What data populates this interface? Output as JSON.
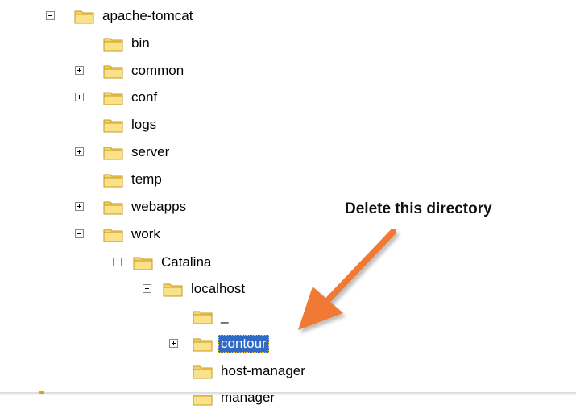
{
  "tree": {
    "nodes": [
      {
        "id": "apache-tomcat",
        "label": "apache-tomcat",
        "toggle": "minus"
      },
      {
        "id": "bin",
        "label": "bin",
        "toggle": "none"
      },
      {
        "id": "common",
        "label": "common",
        "toggle": "plus"
      },
      {
        "id": "conf",
        "label": "conf",
        "toggle": "plus"
      },
      {
        "id": "logs",
        "label": "logs",
        "toggle": "none"
      },
      {
        "id": "server",
        "label": "server",
        "toggle": "plus"
      },
      {
        "id": "temp",
        "label": "temp",
        "toggle": "none"
      },
      {
        "id": "webapps",
        "label": "webapps",
        "toggle": "plus"
      },
      {
        "id": "work",
        "label": "work",
        "toggle": "minus"
      },
      {
        "id": "catalina",
        "label": "Catalina",
        "toggle": "minus"
      },
      {
        "id": "localhost",
        "label": "localhost",
        "toggle": "minus"
      },
      {
        "id": "underscore",
        "label": "_",
        "toggle": "none"
      },
      {
        "id": "contour",
        "label": "contour",
        "toggle": "plus",
        "selected": true
      },
      {
        "id": "host-manager",
        "label": "host-manager",
        "toggle": "none"
      },
      {
        "id": "manager",
        "label": "manager",
        "toggle": "none"
      }
    ]
  },
  "annotation": {
    "text": "Delete this directory",
    "arrow_color": "#f07a35"
  },
  "colors": {
    "selection": "#316ac5",
    "folder_fill": "#f7d774",
    "folder_stroke": "#c89a1a"
  }
}
